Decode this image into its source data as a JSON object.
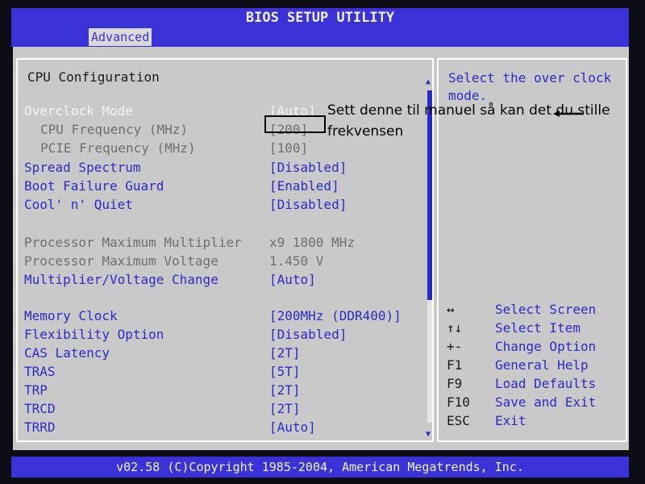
{
  "window": {
    "title": "BIOS SETUP UTILITY",
    "active_tab": "Advanced"
  },
  "section": {
    "title": "CPU Configuration"
  },
  "settings": [
    {
      "label": "Overclock Mode",
      "value": "[Auto]",
      "state": "selected"
    },
    {
      "label": "CPU Frequency (MHz)",
      "value": "[200]",
      "state": "disabled"
    },
    {
      "label": "PCIE Frequency (MHz)",
      "value": "[100]",
      "state": "disabled"
    },
    {
      "label": "Spread Spectrum",
      "value": "[Disabled]",
      "state": "normal"
    },
    {
      "label": "Boot Failure Guard",
      "value": "[Enabled]",
      "state": "normal"
    },
    {
      "label": "Cool' n' Quiet",
      "value": "[Disabled]",
      "state": "normal"
    },
    {
      "label": "Processor Maximum Multiplier",
      "value": "x9  1800 MHz",
      "state": "info"
    },
    {
      "label": "Processor Maximum Voltage",
      "value": "1.450 V",
      "state": "info"
    },
    {
      "label": "Multiplier/Voltage Change",
      "value": "[Auto]",
      "state": "normal"
    },
    {
      "label": "Memory Clock",
      "value": "[200MHz (DDR400)]",
      "state": "normal"
    },
    {
      "label": "Flexibility Option",
      "value": "[Disabled]",
      "state": "normal"
    },
    {
      "label": "CAS Latency",
      "value": "[2T]",
      "state": "normal"
    },
    {
      "label": "TRAS",
      "value": "[5T]",
      "state": "normal"
    },
    {
      "label": "TRP",
      "value": "[2T]",
      "state": "normal"
    },
    {
      "label": "TRCD",
      "value": "[2T]",
      "state": "normal"
    },
    {
      "label": "TRRD",
      "value": "[Auto]",
      "state": "normal"
    }
  ],
  "help": {
    "text": "Select the over clock mode."
  },
  "keys": [
    {
      "key": "↔",
      "desc": "Select Screen"
    },
    {
      "key": "↑↓",
      "desc": "Select Item"
    },
    {
      "key": "+-",
      "desc": "Change Option"
    },
    {
      "key": "F1",
      "desc": "General Help"
    },
    {
      "key": "F9",
      "desc": "Load Defaults"
    },
    {
      "key": "F10",
      "desc": "Save and Exit"
    },
    {
      "key": "ESC",
      "desc": "Exit"
    }
  ],
  "footer": {
    "text": "v02.58 (C)Copyright 1985-2004, American Megatrends, Inc."
  },
  "annotation": {
    "text": "Sett denne til manuel så kan det du stille frekvensen"
  },
  "colors": {
    "bios_blue": "#3a32d6",
    "panel_gray": "#c9c9c9",
    "label_blue": "#2a2bc8",
    "disabled_gray": "#6f6f6f"
  }
}
